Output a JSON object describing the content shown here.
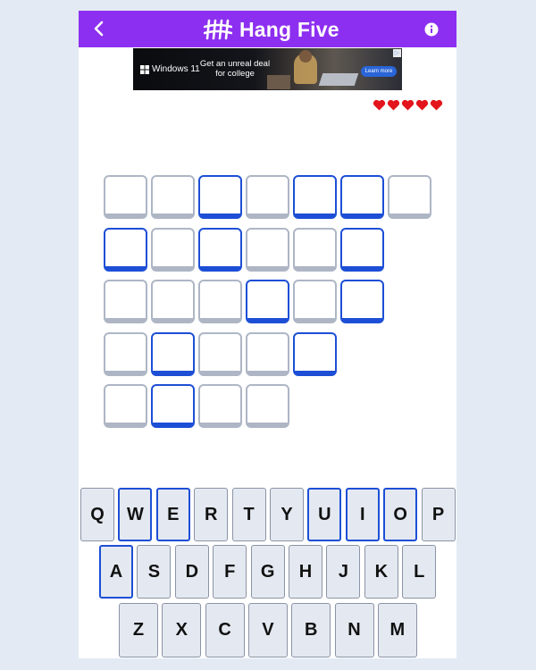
{
  "app": {
    "title": "Hang Five"
  },
  "icons": {
    "back": "chevron-left-icon",
    "logo": "tally-marks-icon",
    "info": "info-icon"
  },
  "colors": {
    "header": "#8d2ff0",
    "revealed_border": "#1d4fd6",
    "hidden_border": "#aeb6c5",
    "heart": "#e3141b"
  },
  "ad": {
    "brand": "Windows 11",
    "copy": "Get an unreal deal for college",
    "cta": "Learn more"
  },
  "lives": {
    "remaining": 5,
    "total": 5
  },
  "board": {
    "rows": [
      [
        false,
        false,
        true,
        false,
        true,
        true,
        false
      ],
      [
        true,
        false,
        true,
        false,
        false,
        true
      ],
      [
        false,
        false,
        false,
        true,
        false,
        true
      ],
      [
        false,
        true,
        false,
        false,
        true
      ],
      [
        false,
        true,
        false,
        false
      ]
    ]
  },
  "keyboard": {
    "rows": [
      [
        "Q",
        "W",
        "E",
        "R",
        "T",
        "Y",
        "U",
        "I",
        "O",
        "P"
      ],
      [
        "A",
        "S",
        "D",
        "F",
        "G",
        "H",
        "J",
        "K",
        "L"
      ],
      [
        "Z",
        "X",
        "C",
        "V",
        "B",
        "N",
        "M"
      ]
    ],
    "used": [
      "W",
      "E",
      "U",
      "I",
      "O",
      "A"
    ]
  }
}
